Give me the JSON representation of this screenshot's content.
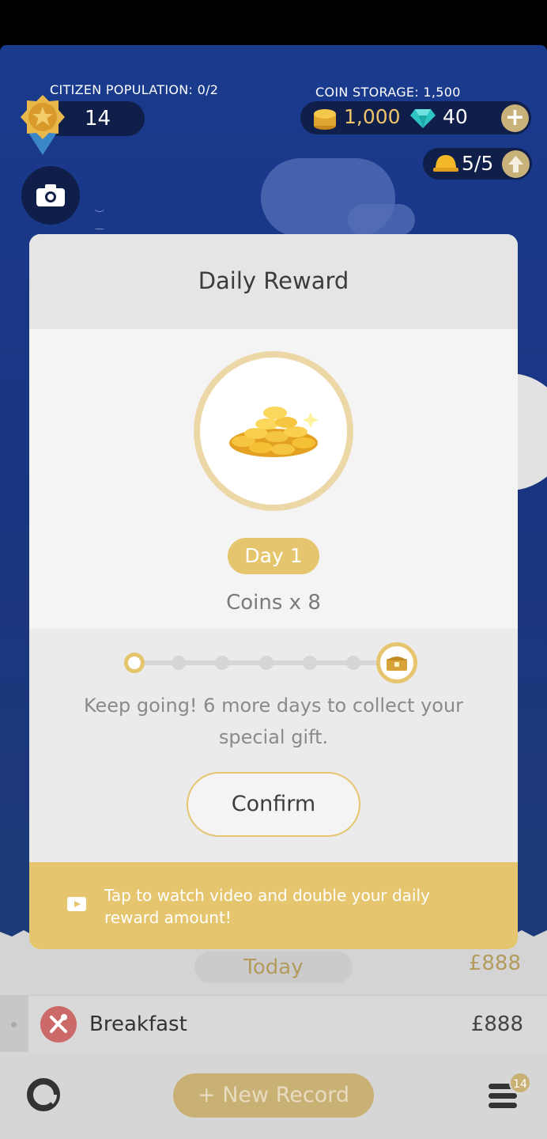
{
  "hud": {
    "citizen_population_label": "CITIZEN POPULATION: 0/2",
    "level": "14",
    "coin_storage_label": "COIN STORAGE: 1,500",
    "coins": "1,000",
    "gems": "40",
    "add_symbol": "+",
    "builders": "5/5"
  },
  "dialog": {
    "title": "Daily Reward",
    "day_label": "Day 1",
    "reward_text": "Coins x 8",
    "progress": {
      "current_day": 1,
      "total_days": 7
    },
    "keep_going_text": "Keep going! 6 more days to collect your special gift.",
    "confirm_label": "Confirm",
    "video_text": "Tap to watch video and double your daily reward amount!"
  },
  "side_card": {
    "symbol": "?"
  },
  "list": {
    "section_label": "Today",
    "section_total": "£888",
    "rows": [
      {
        "label": "Breakfast",
        "amount": "£888"
      }
    ]
  },
  "bottom": {
    "new_record_label": "New Record",
    "new_record_plus": "+",
    "menu_badge": "14"
  },
  "colors": {
    "scene": "#1a3a8e",
    "accent_gold": "#e5c56d",
    "dialog_bg": "#f1f1f1"
  }
}
